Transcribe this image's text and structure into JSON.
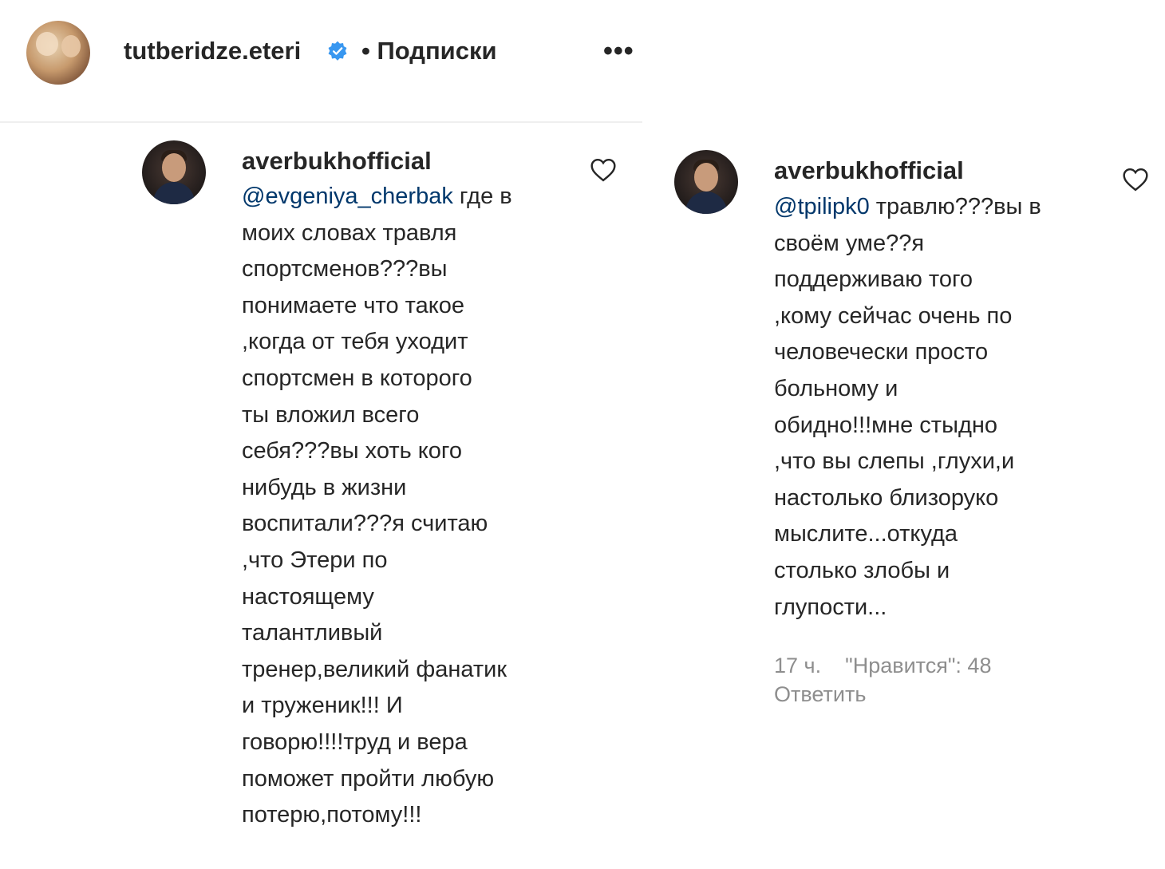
{
  "post_header": {
    "username": "tutberidze.eteri",
    "follow_status": "• Подписки",
    "more_label": "•••"
  },
  "comments": [
    {
      "username": "averbukhofficial",
      "mention": "@evgeniya_cherbak",
      "lines": [
        " где в",
        "моих словах травля",
        "спортсменов???вы",
        "понимаете что такое",
        ",когда от тебя уходит",
        "спортсмен в которого",
        "ты вложил всего",
        "себя???вы хоть кого",
        "нибудь в жизни",
        "воспитали???я считаю",
        ",что Этери по",
        "настоящему",
        "талантливый",
        "тренер,великий фанатик",
        "и труженик!!! И",
        "говорю!!!!труд и вера",
        "поможет пройти любую",
        "потерю,потому!!!"
      ]
    },
    {
      "username": "averbukhofficial",
      "mention": "@tpilipk0",
      "lines": [
        " травлю???вы в",
        "своём уме??я",
        "поддерживаю того",
        ",кому сейчас очень по",
        "человечески просто",
        "больному и",
        "обидно!!!мне стыдно",
        ",что вы слепы ,глухи,и",
        "настолько близоруко",
        "мыслите...откуда",
        "столько злобы и",
        "глупости..."
      ],
      "time": "17 ч.",
      "likes": "\"Нравится\": 48",
      "reply_label": "Ответить"
    }
  ],
  "colors": {
    "text": "#262626",
    "mention": "#00376b",
    "secondary": "#8e8e8e",
    "verified": "#3897f0"
  }
}
